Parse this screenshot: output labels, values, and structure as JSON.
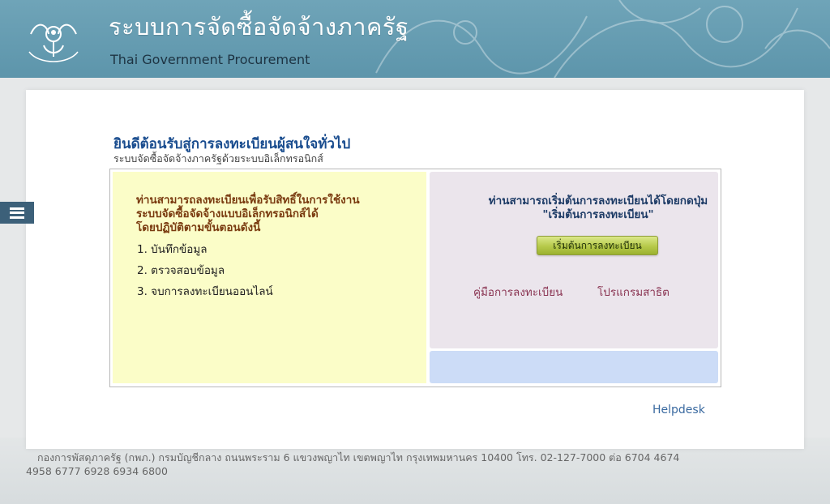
{
  "header": {
    "title_th": "ระบบการจัดซื้อจัดจ้างภาครัฐ",
    "title_en": "Thai Government Procurement",
    "logo_icon": "comptroller-general-garuda-logo-icon",
    "logo_text": "กรมบัญชีกลาง"
  },
  "menu": {
    "icon": "hamburger-menu-icon"
  },
  "welcome": {
    "title": "ยินดีต้อนรับสู่การลงทะเบียนผู้สนใจทั่วไป",
    "subtitle": "ระบบจัดซื้อจัดจ้างภาครัฐด้วยระบบอิเล็กทรอนิกส์"
  },
  "left_panel": {
    "heading": "ท่านสามารถลงทะเบียนเพื่อรับสิทธิ์ในการใช้งานระบบจัดซื้อจัดจ้างแบบอิเล็กทรอนิกส์ได้ โดยปฏิบัติตามขั้นตอนดังนี้",
    "heading_lines": [
      "ท่านสามารถลงทะเบียนเพื่อรับสิทธิ์ในการใช้งาน",
      "ระบบจัดซื้อจัดจ้างแบบอิเล็กทรอนิกส์ได้",
      "โดยปฏิบัติตามขั้นตอนดังนี้"
    ],
    "steps": [
      "1. บันทึกข้อมูล",
      "2. ตรวจสอบข้อมูล",
      "3. จบการลงทะเบียนออนไลน์"
    ]
  },
  "right_panel": {
    "heading_lines": [
      "ท่านสามารถเริ่มต้นการลงทะเบียนได้โดยกดปุ่ม",
      "\"เริ่มต้นการลงทะเบียน\""
    ],
    "start_button_label": "เริ่มต้นการลงทะเบียน",
    "links": [
      "คู่มือการลงทะเบียน",
      "โปรแกรมสาธิต"
    ]
  },
  "helpdesk_label": "Helpdesk",
  "footer": "กองการพัสดุภาครัฐ (กพภ.) กรมบัญชีกลาง ถนนพระราม 6 แขวงพญาไท เขตพญาไท กรุงเทพมหานคร 10400 โทร. 02-127-7000 ต่อ 6704 4674 4958 6777 6928 6934 6800",
  "colors": {
    "header_bg": "#5d95ab",
    "welcome_title": "#1a4d8f",
    "left_box_bg": "#fbfdc8",
    "left_heading": "#7a3b10",
    "right_top_bg": "#ebe5ec",
    "right_bottom_bg": "#ccdcf7",
    "right_heading": "#1d3b66",
    "link": "#8a3452",
    "button": "#b6c94a",
    "menu_toggle": "#3c6079"
  }
}
